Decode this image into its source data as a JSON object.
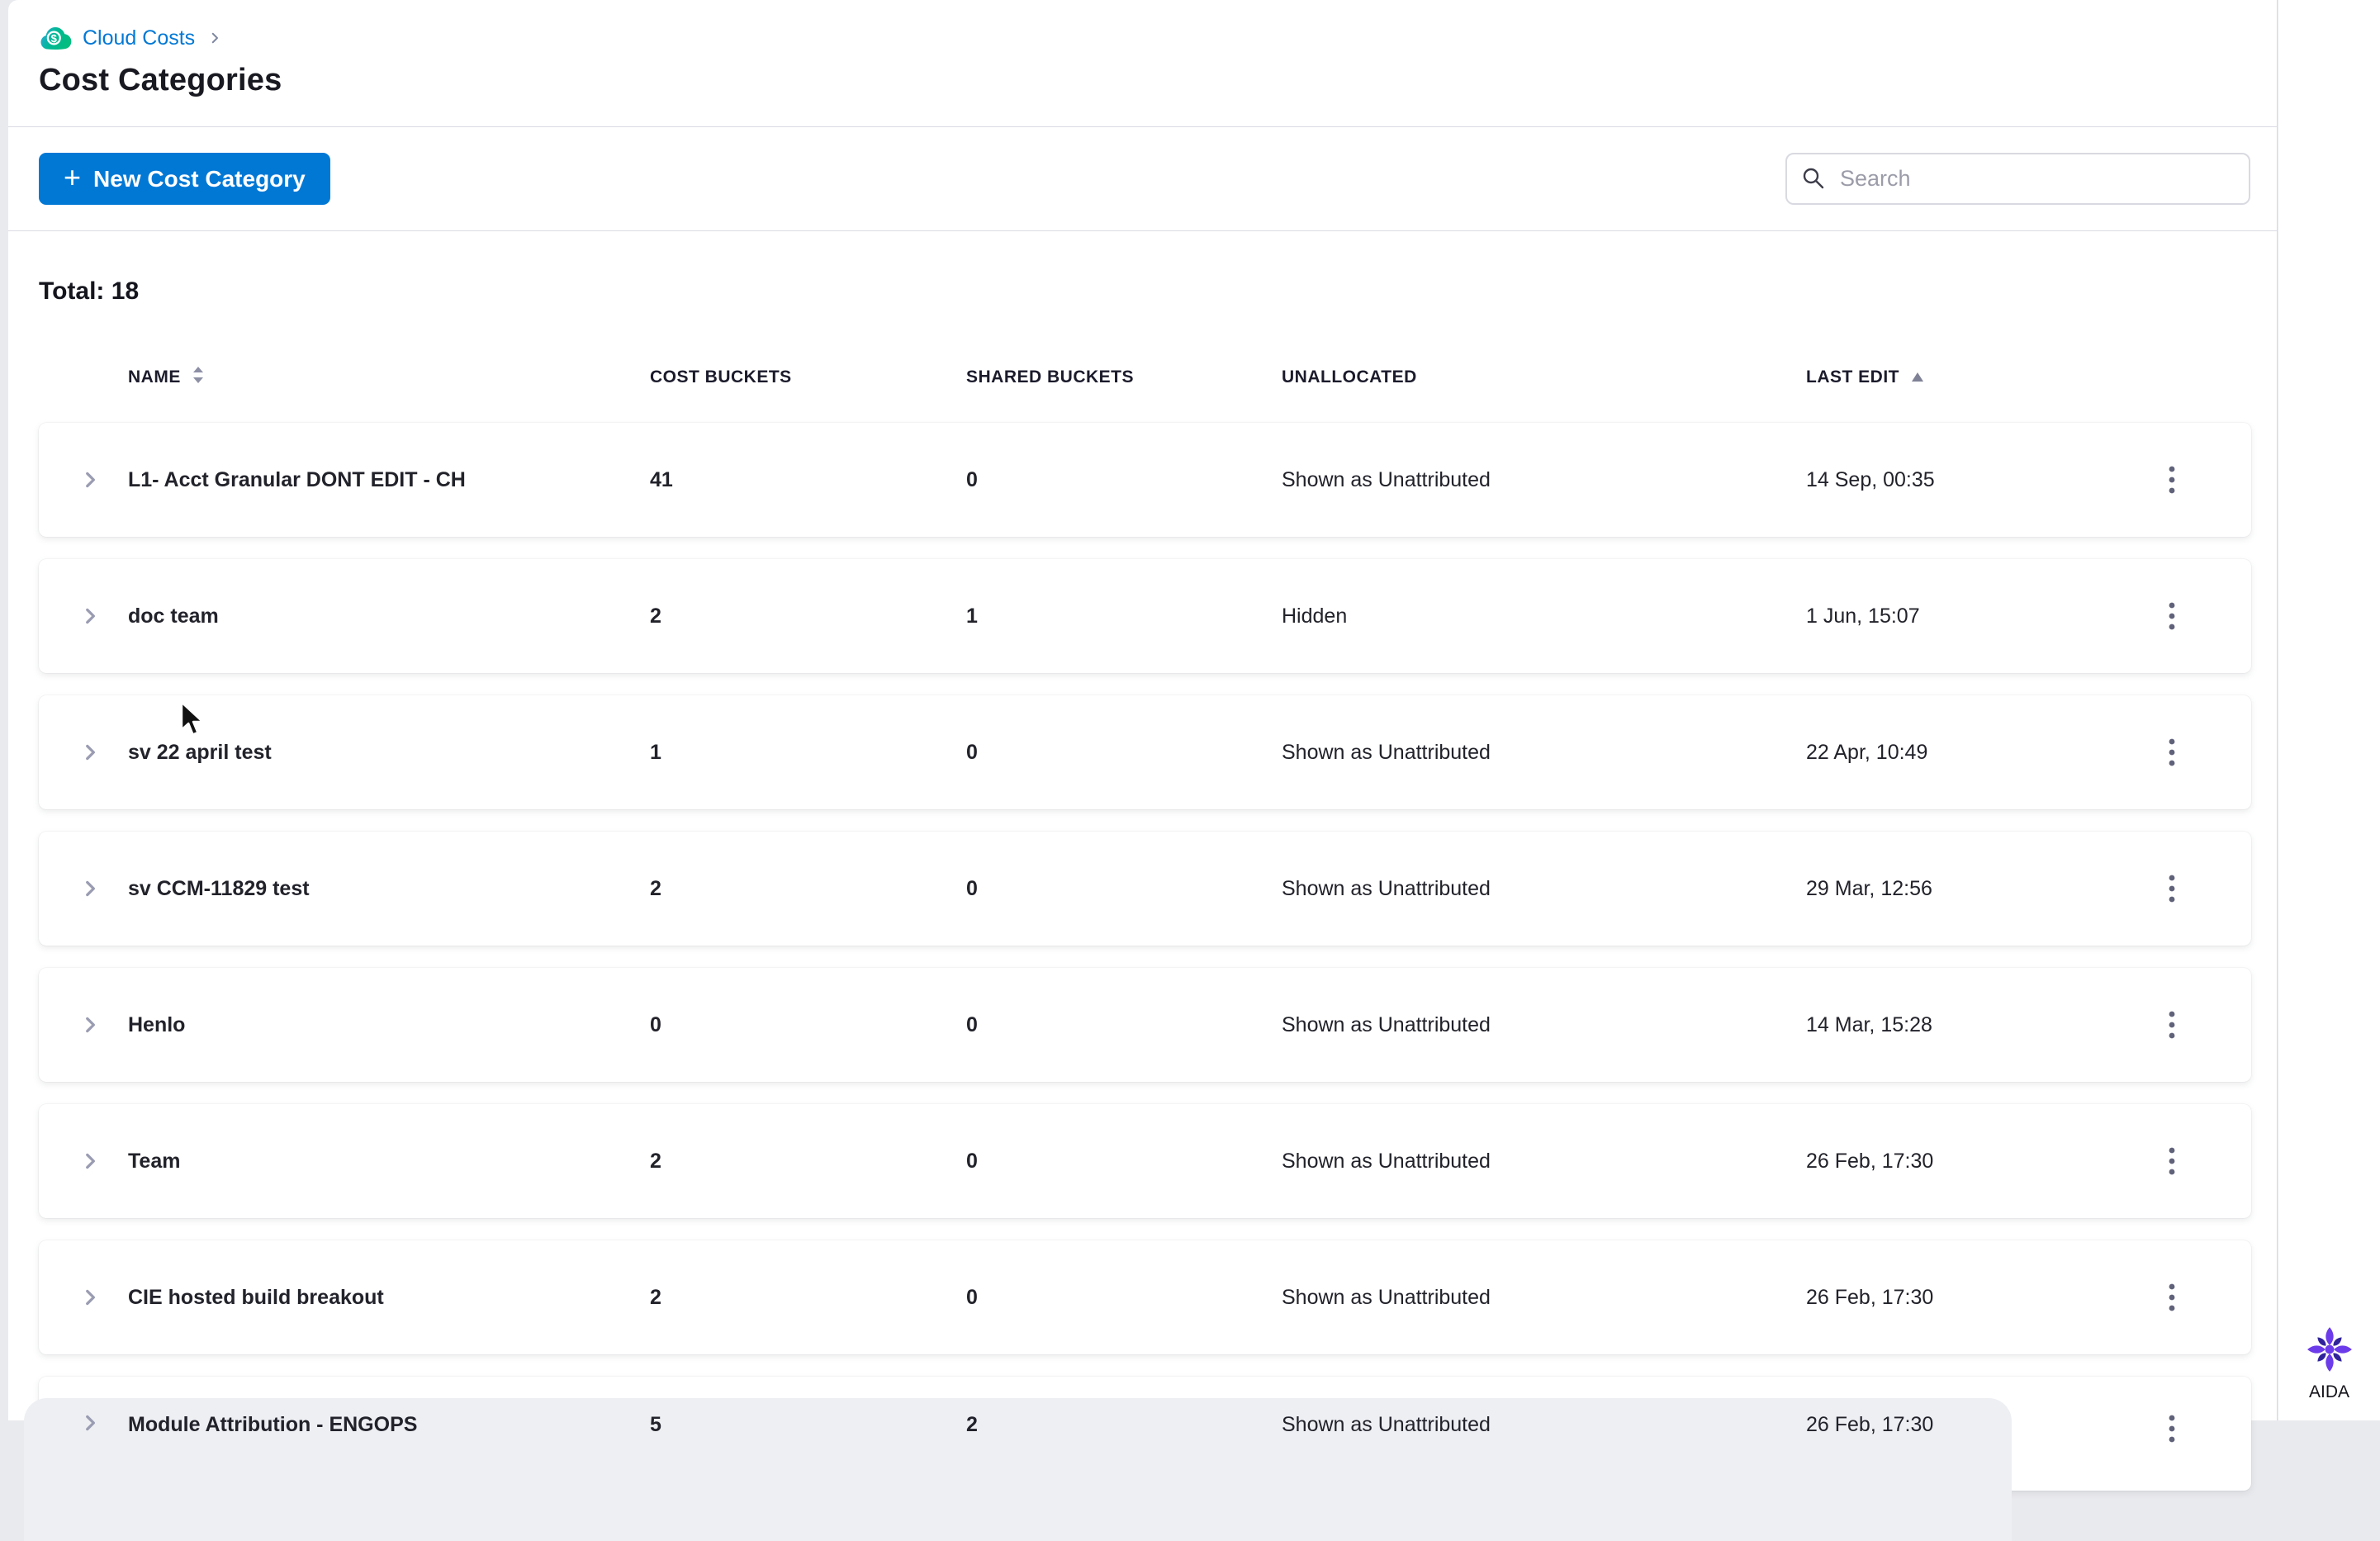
{
  "colors": {
    "primary_blue": "#0278d5",
    "aida_purple": "#6c3bea",
    "module_teal": "#00b894"
  },
  "header": {
    "breadcrumb": {
      "module_icon": "cloud-dollar-icon",
      "label": "Cloud Costs"
    },
    "title": "Cost Categories"
  },
  "toolbar": {
    "new_button_plus": "+",
    "new_button_label": "New Cost Category",
    "search_placeholder": "Search"
  },
  "summary": {
    "total_label": "Total:",
    "total_value": "18"
  },
  "table": {
    "columns": [
      "NAME",
      "COST BUCKETS",
      "SHARED BUCKETS",
      "UNALLOCATED",
      "LAST EDIT"
    ],
    "sort": {
      "column": "LAST EDIT",
      "direction": "asc"
    },
    "rows": [
      {
        "name": "L1- Acct Granular DONT EDIT - CH",
        "cost_buckets": "41",
        "shared_buckets": "0",
        "unallocated": "Shown as Unattributed",
        "last_edit": "14 Sep, 00:35"
      },
      {
        "name": "doc team",
        "cost_buckets": "2",
        "shared_buckets": "1",
        "unallocated": "Hidden",
        "last_edit": "1 Jun, 15:07"
      },
      {
        "name": "sv 22 april test",
        "cost_buckets": "1",
        "shared_buckets": "0",
        "unallocated": "Shown as Unattributed",
        "last_edit": "22 Apr, 10:49"
      },
      {
        "name": "sv CCM-11829 test",
        "cost_buckets": "2",
        "shared_buckets": "0",
        "unallocated": "Shown as Unattributed",
        "last_edit": "29 Mar, 12:56"
      },
      {
        "name": "Henlo",
        "cost_buckets": "0",
        "shared_buckets": "0",
        "unallocated": "Shown as Unattributed",
        "last_edit": "14 Mar, 15:28"
      },
      {
        "name": "Team",
        "cost_buckets": "2",
        "shared_buckets": "0",
        "unallocated": "Shown as Unattributed",
        "last_edit": "26 Feb, 17:30"
      },
      {
        "name": "CIE hosted build breakout",
        "cost_buckets": "2",
        "shared_buckets": "0",
        "unallocated": "Shown as Unattributed",
        "last_edit": "26 Feb, 17:30"
      },
      {
        "name": "Module Attribution - ENGOPS",
        "cost_buckets": "5",
        "shared_buckets": "2",
        "unallocated": "Shown as Unattributed",
        "last_edit": "26 Feb, 17:30"
      }
    ]
  },
  "aida": {
    "icon": "aida-flower-icon",
    "label": "AIDA"
  }
}
